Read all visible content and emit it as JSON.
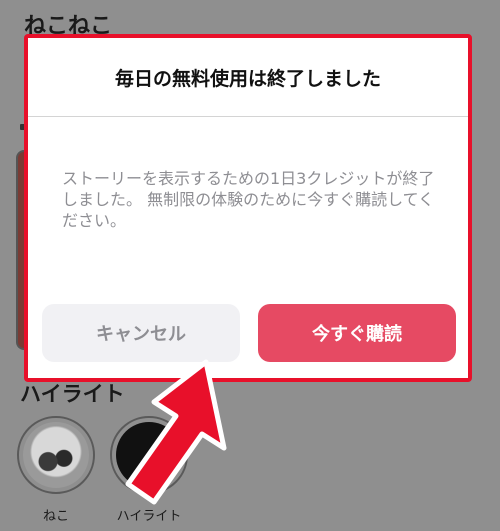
{
  "background": {
    "profile_title": "ねこねこ",
    "highlights_heading": "ハイライト",
    "highlights": [
      {
        "label": "ねこ"
      },
      {
        "label": "ハイライト"
      }
    ]
  },
  "dialog": {
    "title": "毎日の無料使用は終了しました",
    "message": "ストーリーを表示するための1日3クレジットが終了しました。 無制限の体験のために今すぐ購読してください。",
    "cancel_label": "キャンセル",
    "subscribe_label": "今すぐ購読"
  },
  "colors": {
    "accent": "#e64a63",
    "annotation": "#e8102a",
    "overlay": "#8f8f8f"
  }
}
